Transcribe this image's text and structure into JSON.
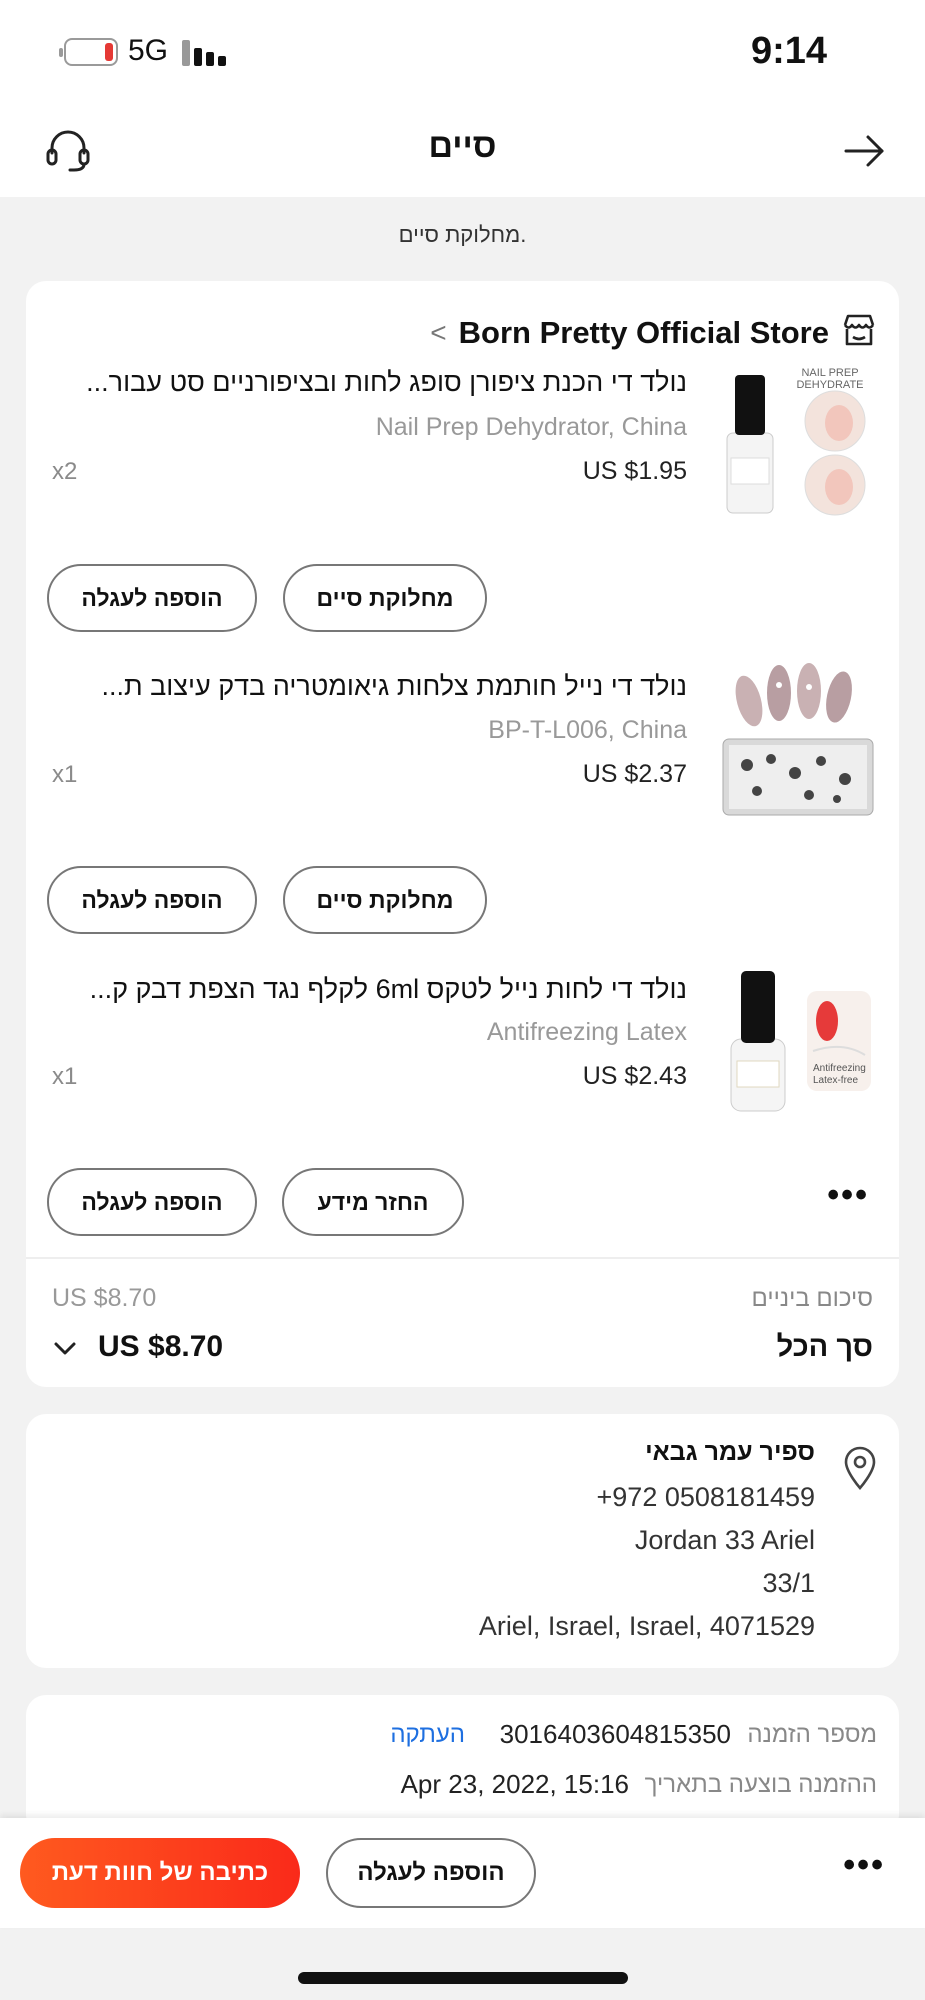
{
  "status_bar": {
    "network": "5G",
    "time": "9:14"
  },
  "header": {
    "title": "סיים",
    "icons": {
      "back": "arrow-right-icon",
      "support": "headset-icon"
    }
  },
  "subheading": "מחלוקת סיים.",
  "store": {
    "name": "Born Pretty Official Store",
    "icon": "store-icon"
  },
  "items": [
    {
      "title": "נולד די הכנת ציפורן סופג לחות ובציפורניים סט עבור...",
      "sku": "Nail Prep Dehydrator, China",
      "price": "US $1.95",
      "qty": "x2",
      "image_label": "NAIL PREP DEHYDRATE",
      "buttons": [
        "הוספה לעגלה",
        "מחלוקת סיים"
      ]
    },
    {
      "title": "נולד די נייל חותמת צלחות גיאומטריה בדק עיצוב ת...",
      "sku": "BP-T-L006, China",
      "price": "US $2.37",
      "qty": "x1",
      "buttons": [
        "הוספה לעגלה",
        "מחלוקת סיים"
      ]
    },
    {
      "title": "נולד די לחות נייל לטקס 6ml לקלף נגד הצפת דבק ק...",
      "sku": "Antifreezing Latex",
      "price": "US $2.43",
      "qty": "x1",
      "image_label": "Antifreezing Latex-free",
      "buttons": [
        "הוספה לעגלה",
        "החזר מידע"
      ]
    }
  ],
  "summary": {
    "subtotal_label": "סיכום ביניים",
    "subtotal_value": "US $8.70",
    "total_label": "סך הכל",
    "total_value": "US $8.70"
  },
  "address": {
    "name": "ספיר עמר גבאי",
    "phone": "+972 0508181459",
    "street": "Jordan 33 Ariel",
    "unit": "33/1",
    "city": "Ariel, Israel, Israel, 4071529"
  },
  "order": {
    "number_label": "מספר הזמנה",
    "number": "3016403604815350",
    "copy_label": "העתקה",
    "date_label": "ההזמנה בוצעה בתאריך",
    "date": "Apr 23, 2022, 15:16"
  },
  "bottom_bar": {
    "add_to_cart": "הוספה לעגלה",
    "write_review": "כתיבה של חוות דעת"
  },
  "colors": {
    "accent": "#ff4a1c",
    "link": "#1e6fe0",
    "battery_low": "#e53935"
  }
}
